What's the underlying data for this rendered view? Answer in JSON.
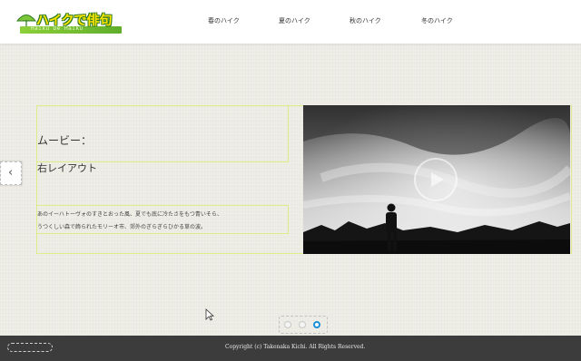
{
  "header": {
    "logo": {
      "title": "ハイクで俳句",
      "subtitle": "Haiku De Haiku",
      "colors": {
        "title": "#ffe600",
        "bar": "#6dbd2f",
        "outline": "#2f7a1e"
      }
    },
    "nav": [
      {
        "label": "春のハイク"
      },
      {
        "label": "夏のハイク"
      },
      {
        "label": "秋のハイク"
      },
      {
        "label": "冬のハイク"
      }
    ]
  },
  "slide": {
    "title": "ムービー：",
    "subtitle": "右レイアウト",
    "description": [
      "あのイーハトーヴォのすきとおった風、夏でも底に冷たさをもつ青いそら、",
      "うつくしい森で飾られたモリーオ市、郊外のぎらぎらひかる草の波。"
    ],
    "video": {
      "icon": "play-icon"
    }
  },
  "carousel": {
    "prev_icon": "chevron-left-icon",
    "dots": [
      {
        "active": false
      },
      {
        "active": false
      },
      {
        "active": true
      }
    ],
    "active_color": "#1a8fd8"
  },
  "footer": {
    "copyright": "Copyright (c) Takenaka Kichi. All Rights Reserved."
  }
}
